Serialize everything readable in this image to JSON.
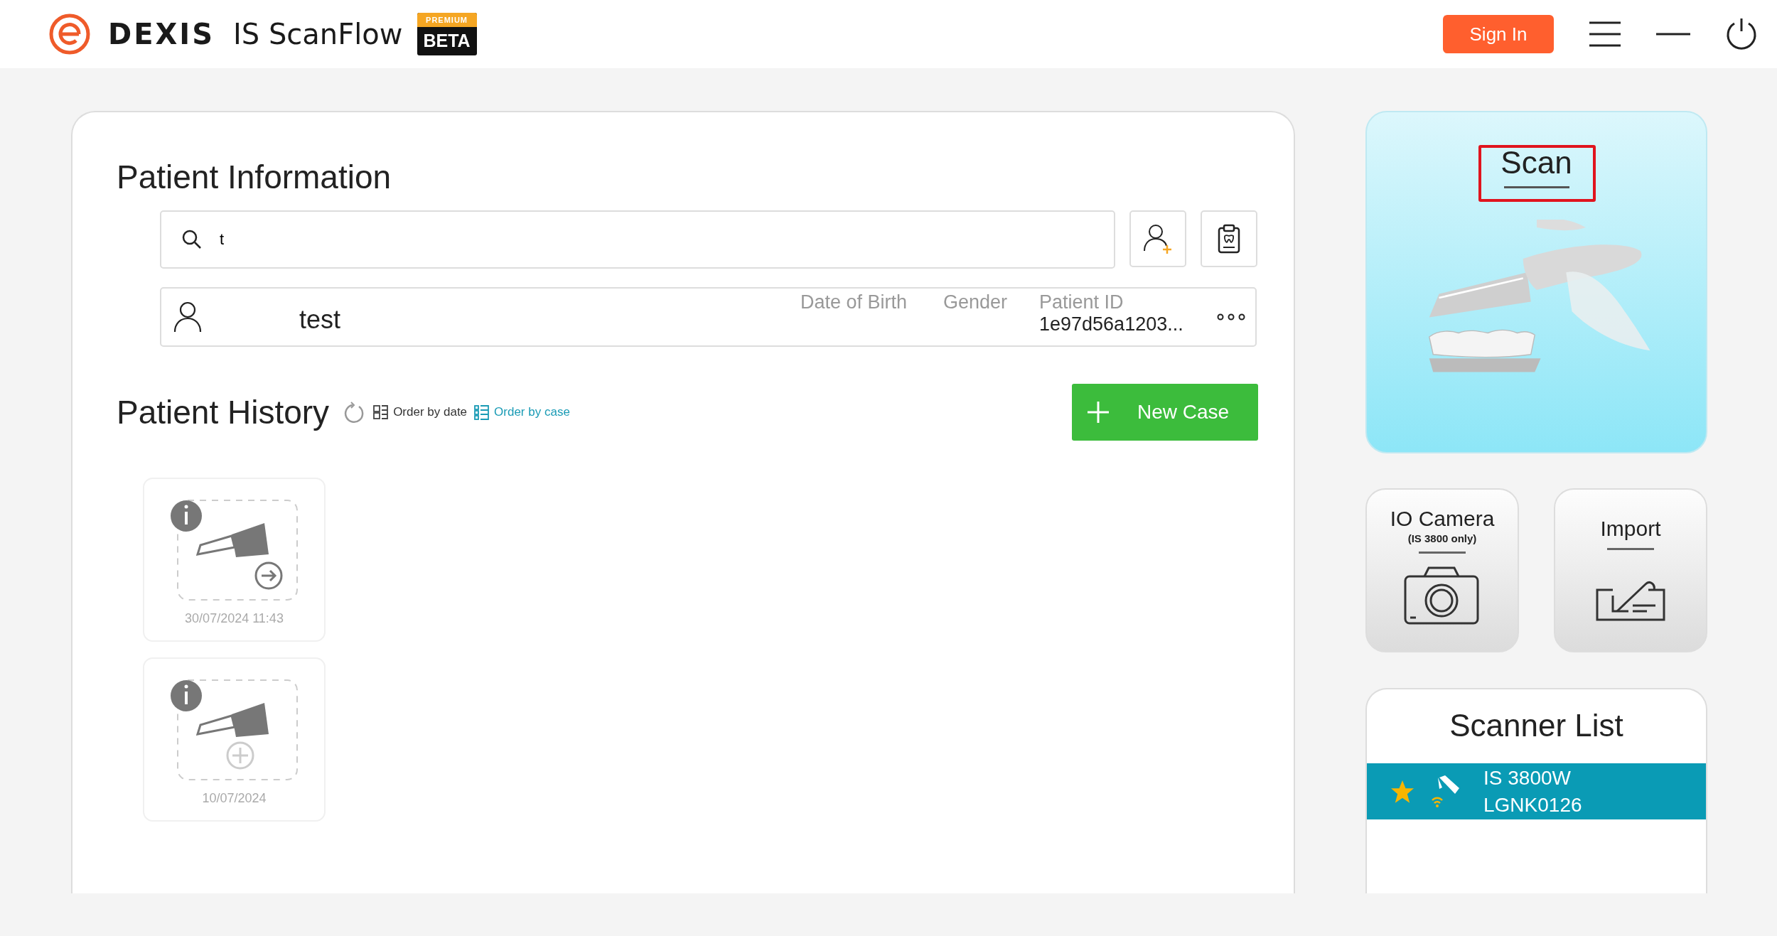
{
  "header": {
    "brand": "DEXIS",
    "product": "IS ScanFlow",
    "badge_top": "PREMIUM",
    "badge": "BETA",
    "sign_in": "Sign In"
  },
  "patient_information": {
    "title": "Patient Information",
    "search": {
      "value": "t"
    },
    "patient": {
      "name": "test",
      "fields": [
        {
          "label": "Date of Birth"
        },
        {
          "label": "Gender"
        },
        {
          "label": "Patient ID",
          "value": "1e97d56a1203..."
        }
      ]
    }
  },
  "patient_history": {
    "title": "Patient History",
    "order_options": [
      {
        "kind": "date",
        "label": "Order by date",
        "selected": false
      },
      {
        "kind": "case",
        "label": "Order by case",
        "selected": true
      }
    ],
    "new_case": "New Case",
    "cases": [
      {
        "kind": "open",
        "date": "30/07/2024 11:43"
      },
      {
        "kind": "new",
        "date": "10/07/2024"
      }
    ]
  },
  "scan": {
    "label": "Scan",
    "highlighted": true
  },
  "tiles": [
    {
      "kind": "camera",
      "label": "IO Camera",
      "note": "(IS 3800 only)"
    },
    {
      "kind": "import",
      "label": "Import"
    }
  ],
  "scanner_list": {
    "title": "Scanner List",
    "scanners": [
      {
        "model": "IS 3800W",
        "serial": "LGNK0126",
        "favorite": true,
        "selected": true
      }
    ]
  }
}
